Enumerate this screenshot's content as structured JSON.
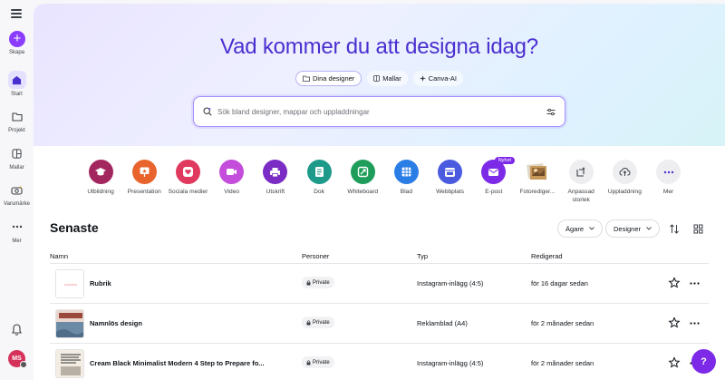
{
  "sidebar": {
    "create_label": "Skapa",
    "items": [
      {
        "label": "Start",
        "icon": "home-icon"
      },
      {
        "label": "Projekt",
        "icon": "folder-icon"
      },
      {
        "label": "Mallar",
        "icon": "templates-icon"
      },
      {
        "label": "Varumärke",
        "icon": "brand-icon"
      },
      {
        "label": "Mer",
        "icon": "more-icon"
      }
    ],
    "avatar_initials": "MS"
  },
  "hero": {
    "title": "Vad kommer du att designa idag?",
    "pills": [
      {
        "label": "Dina designer",
        "active": true
      },
      {
        "label": "Mallar",
        "active": false
      },
      {
        "label": "Canva-AI",
        "active": false
      }
    ],
    "search_placeholder": "Sök bland designer, mappar och uppladdningar"
  },
  "shortcuts": [
    {
      "label": "Utbildning",
      "color": "#a3275f",
      "icon": "graduation-cap-icon"
    },
    {
      "label": "Presentation",
      "color": "#e8642c",
      "icon": "presentation-icon"
    },
    {
      "label": "Sociala medier",
      "color": "#e03a5f",
      "icon": "heart-icon"
    },
    {
      "label": "Video",
      "color": "#c44ddb",
      "icon": "video-icon"
    },
    {
      "label": "Utskrift",
      "color": "#7b2cc4",
      "icon": "print-icon"
    },
    {
      "label": "Dok",
      "color": "#1d9a8a",
      "icon": "doc-icon"
    },
    {
      "label": "Whiteboard",
      "color": "#1e9e5a",
      "icon": "whiteboard-icon"
    },
    {
      "label": "Blad",
      "color": "#2b7de6",
      "icon": "sheet-icon"
    },
    {
      "label": "Webbplats",
      "color": "#4b5be0",
      "icon": "website-icon"
    },
    {
      "label": "E-post",
      "color": "#7d2ae8",
      "icon": "email-icon",
      "badge": "Nyhet"
    },
    {
      "label": "Fotorediger...",
      "color": "#c79a5b",
      "icon": "photo-edit-icon"
    },
    {
      "label": "Anpassad storlek",
      "color": "#eeeef1",
      "icon": "custom-size-icon"
    },
    {
      "label": "Uppladdning",
      "color": "#eeeef1",
      "icon": "upload-icon"
    },
    {
      "label": "Mer",
      "color": "#eeeef1",
      "icon": "more-horizontal-icon"
    }
  ],
  "recent": {
    "title": "Senaste",
    "owner_filter": "Ägare",
    "type_filter": "Designer",
    "columns": {
      "name": "Namn",
      "people": "Personer",
      "type": "Typ",
      "edited": "Redigerad"
    },
    "rows": [
      {
        "name": "Rubrik",
        "privacy": "Private",
        "type": "Instagram-inlägg (4:5)",
        "edited": "för 16 dagar sedan"
      },
      {
        "name": "Namnlös design",
        "privacy": "Private",
        "type": "Reklamblad (A4)",
        "edited": "för 2 månader sedan"
      },
      {
        "name": "Cream Black Minimalist Modern 4 Step to Prepare fo...",
        "privacy": "Private",
        "type": "Instagram-inlägg (4:5)",
        "edited": "för 2 månader sedan"
      }
    ]
  },
  "help_label": "?"
}
